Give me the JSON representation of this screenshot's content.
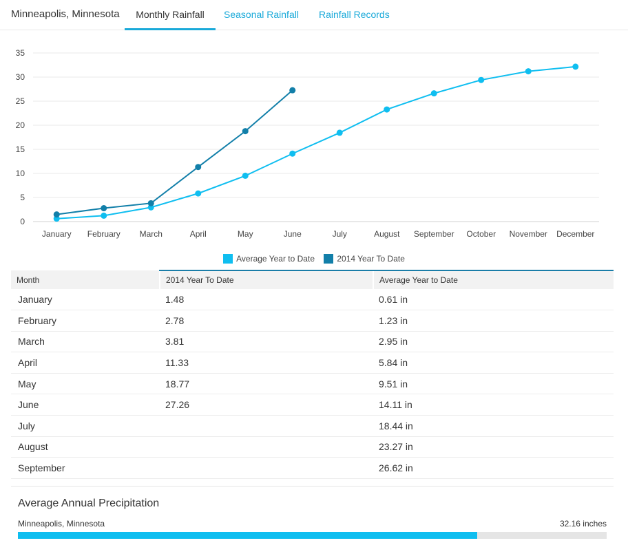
{
  "header": {
    "location": "Minneapolis, Minnesota",
    "tabs": [
      {
        "label": "Monthly Rainfall",
        "active": true
      },
      {
        "label": "Seasonal Rainfall",
        "active": false
      },
      {
        "label": "Rainfall Records",
        "active": false
      }
    ]
  },
  "colors": {
    "average": "#0fbef0",
    "y2014": "#127fa9",
    "accent": "#19a9d9"
  },
  "chart_data": {
    "type": "line",
    "categories": [
      "January",
      "February",
      "March",
      "April",
      "May",
      "June",
      "July",
      "August",
      "September",
      "October",
      "November",
      "December"
    ],
    "series": [
      {
        "name": "Average Year to Date",
        "values": [
          0.61,
          1.23,
          2.95,
          5.84,
          9.51,
          14.11,
          18.44,
          23.27,
          26.62,
          29.4,
          31.2,
          32.16
        ]
      },
      {
        "name": "2014 Year To Date",
        "values": [
          1.48,
          2.78,
          3.81,
          11.33,
          18.77,
          27.26
        ]
      }
    ],
    "yticks": [
      "0",
      "5",
      "10",
      "15",
      "20",
      "25",
      "30",
      "35"
    ],
    "ylim": [
      0,
      35
    ],
    "grid": true,
    "legend_position": "bottom-center"
  },
  "table": {
    "headers": [
      "Month",
      "2014 Year To Date",
      "Average Year to Date"
    ],
    "rows": [
      [
        "January",
        "1.48",
        "0.61 in"
      ],
      [
        "February",
        "2.78",
        "1.23 in"
      ],
      [
        "March",
        "3.81",
        "2.95 in"
      ],
      [
        "April",
        "11.33",
        "5.84 in"
      ],
      [
        "May",
        "18.77",
        "9.51 in"
      ],
      [
        "June",
        "27.26",
        "14.11 in"
      ],
      [
        "July",
        "",
        "18.44 in"
      ],
      [
        "August",
        "",
        "23.27 in"
      ],
      [
        "September",
        "",
        "26.62 in"
      ]
    ]
  },
  "annual": {
    "title": "Average Annual Precipitation",
    "city": "Minneapolis, Minnesota",
    "value_label": "32.16 inches",
    "fill_fraction": 0.78
  }
}
